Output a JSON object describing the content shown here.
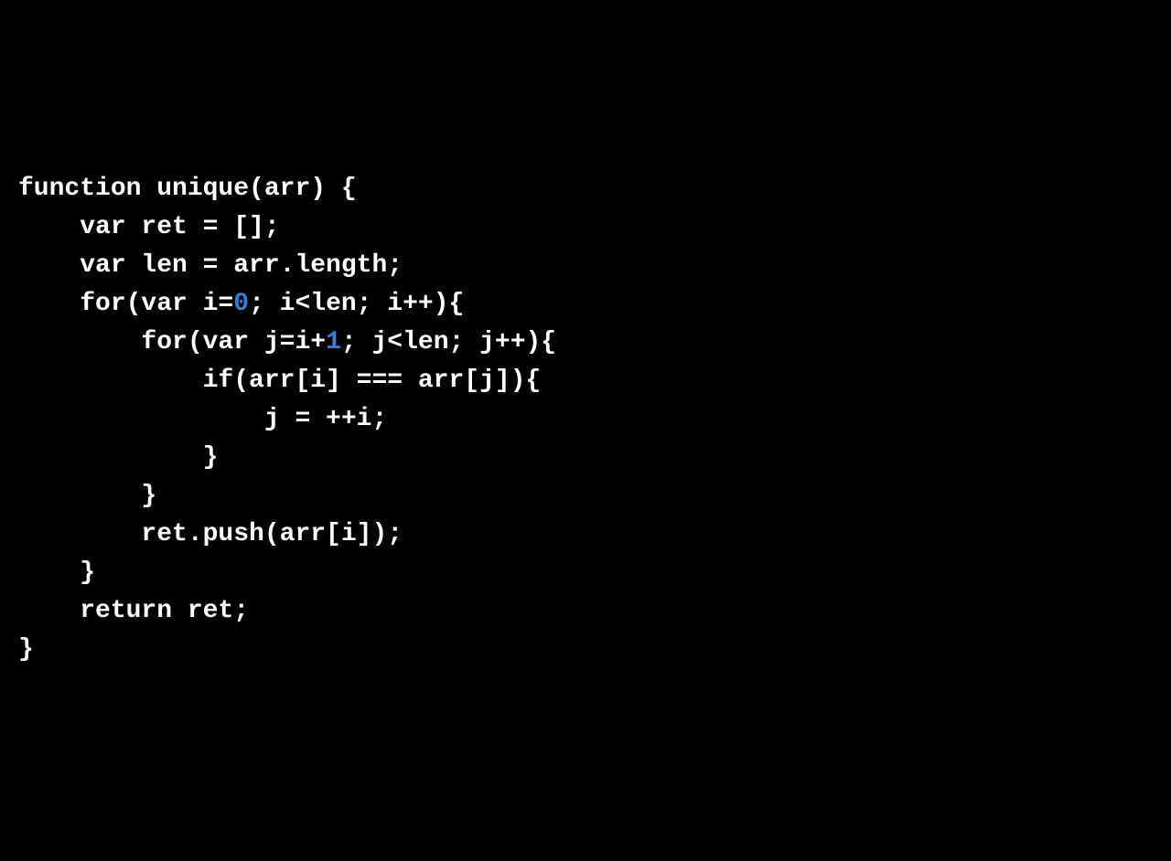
{
  "code": {
    "line1_a": "function unique(arr) {",
    "line2_a": "    var ret = [];",
    "line3_a": "    var len = arr.length;",
    "line4_a": "    for(var i=",
    "line4_num": "0",
    "line4_b": "; i<len; i++){",
    "line5_a": "        for(var j=i+",
    "line5_num": "1",
    "line5_b": "; j<len; j++){",
    "line6_a": "            if(arr[i] === arr[j]){",
    "line7_a": "                j = ++i;",
    "line8_a": "            }",
    "line9_a": "        }",
    "line10_a": "        ret.push(arr[i]);",
    "line11_a": "    }",
    "line12_a": "    return ret;",
    "line13_a": "}"
  }
}
